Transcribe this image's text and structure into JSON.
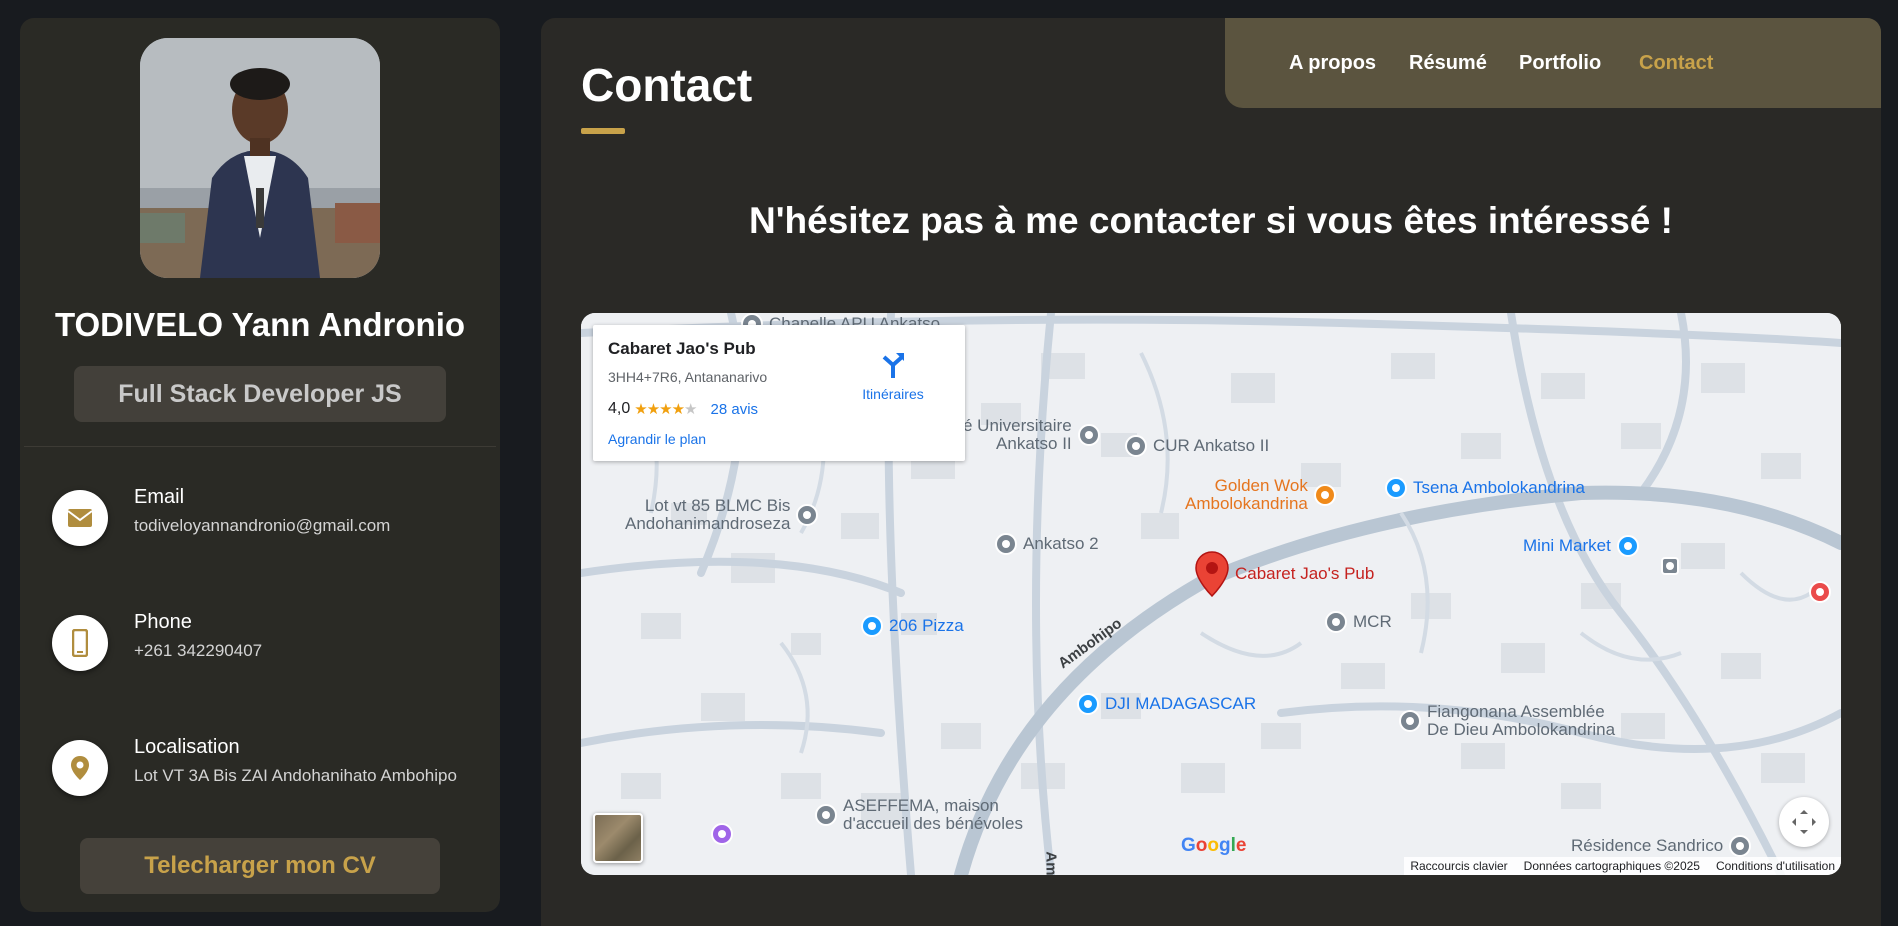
{
  "profile": {
    "name": "TODIVELO Yann Andronio",
    "role": "Full Stack Developer JS"
  },
  "contacts": [
    {
      "title": "Email",
      "value": "todiveloyannandronio@gmail.com",
      "icon": "envelope-icon"
    },
    {
      "title": "Phone",
      "value": "+261 342290407",
      "icon": "phone-icon"
    },
    {
      "title": "Localisation",
      "value": "Lot VT 3A Bis ZAI Andohanihato Ambohipo",
      "icon": "location-pin-icon"
    }
  ],
  "cv_button": "Telecharger mon CV",
  "nav": {
    "items": [
      "A propos",
      "Résumé",
      "Portfolio",
      "Contact"
    ],
    "active": "Contact"
  },
  "page": {
    "title": "Contact",
    "tagline": "N'hésitez pas à me contacter si vous êtes intéressé !"
  },
  "map": {
    "card": {
      "title": "Cabaret Jao's Pub",
      "address": "3HH4+7R6, Antananarivo",
      "rating": "4,0",
      "stars": "★★★★",
      "stars_empty": "★",
      "reviews": "28 avis",
      "directions": "Itinéraires",
      "enlarge": "Agrandir le plan"
    },
    "places": {
      "chapelle": "Chapelle APU Ankatso",
      "universitaire_1": "é Universitaire",
      "universitaire_2": "Ankatso II",
      "cur": "CUR Ankatso II",
      "golden_1": "Golden Wok",
      "golden_2": "Ambolokandrina",
      "tsena": "Tsena Ambolokandrina",
      "lot_1": "Lot vt 85 BLMC Bis",
      "lot_2": "Andohanimandroseza",
      "ankatso2": "Ankatso 2",
      "mini_market": "Mini Market",
      "jao": "Cabaret Jao's Pub",
      "pizza": "206 Pizza",
      "mcr": "MCR",
      "ambohipo": "Ambohipo",
      "dji": "DJI MADAGASCAR",
      "fiangonana_1": "Fiangonana Assemblée",
      "fiangonana_2": "De Dieu Ambolokandrina",
      "aseffema_1": "ASEFFEMA, maison",
      "aseffema_2": "d'accueil des bénévoles",
      "residence": "Résidence Sandrico",
      "road_bottom": "Am"
    },
    "footer": {
      "shortcuts": "Raccourcis clavier",
      "data": "Données cartographiques ©2025",
      "terms": "Conditions d'utilisation"
    },
    "brand": "Google",
    "colors": {
      "blue": "#4285F4",
      "red": "#EA4335",
      "yellow": "#FBBC05",
      "green": "#34A853"
    }
  },
  "theme": {
    "accent": "#c8a24a",
    "panel": "#2a2a25",
    "nav": "#5b543f"
  }
}
